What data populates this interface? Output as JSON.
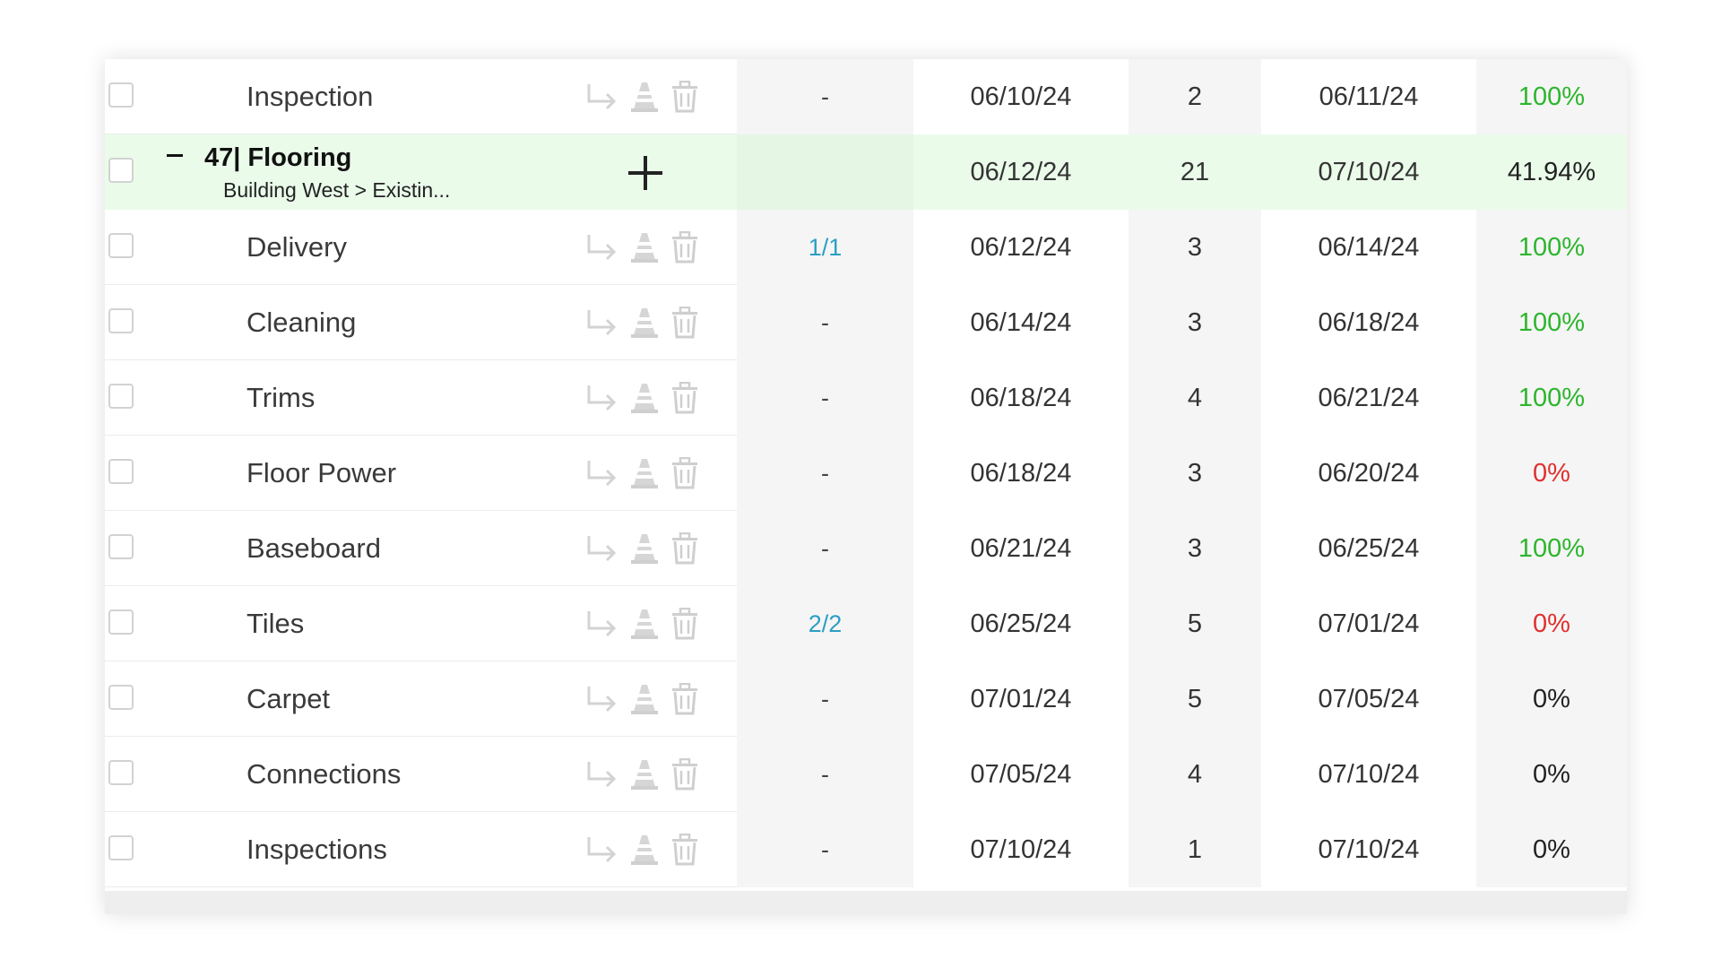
{
  "colors": {
    "group_bg": "#eafbea",
    "link": "#2a9fc4",
    "complete": "#2db52d",
    "not_started": "#e03030",
    "neutral": "#222222"
  },
  "icons": {
    "indent": "indent-arrow-icon",
    "constraint": "cone-icon",
    "delete": "trash-icon",
    "collapse": "minus-icon",
    "add": "plus-icon"
  },
  "rows": [
    {
      "type": "task",
      "name": "Inspection",
      "sub": "-",
      "start": "06/10/24",
      "duration": "2",
      "end": "06/11/24",
      "percent": "100%",
      "status": "green"
    },
    {
      "type": "group",
      "name": "47| Flooring",
      "path": "Building West > Existin...",
      "sub": "",
      "start": "06/12/24",
      "duration": "21",
      "end": "07/10/24",
      "percent": "41.94%",
      "status": "black"
    },
    {
      "type": "task",
      "name": "Delivery",
      "sub": "1/1",
      "start": "06/12/24",
      "duration": "3",
      "end": "06/14/24",
      "percent": "100%",
      "status": "green"
    },
    {
      "type": "task",
      "name": "Cleaning",
      "sub": "-",
      "start": "06/14/24",
      "duration": "3",
      "end": "06/18/24",
      "percent": "100%",
      "status": "green"
    },
    {
      "type": "task",
      "name": "Trims",
      "sub": "-",
      "start": "06/18/24",
      "duration": "4",
      "end": "06/21/24",
      "percent": "100%",
      "status": "green"
    },
    {
      "type": "task",
      "name": "Floor Power",
      "sub": "-",
      "start": "06/18/24",
      "duration": "3",
      "end": "06/20/24",
      "percent": "0%",
      "status": "red"
    },
    {
      "type": "task",
      "name": "Baseboard",
      "sub": "-",
      "start": "06/21/24",
      "duration": "3",
      "end": "06/25/24",
      "percent": "100%",
      "status": "green"
    },
    {
      "type": "task",
      "name": "Tiles",
      "sub": "2/2",
      "start": "06/25/24",
      "duration": "5",
      "end": "07/01/24",
      "percent": "0%",
      "status": "red"
    },
    {
      "type": "task",
      "name": "Carpet",
      "sub": "-",
      "start": "07/01/24",
      "duration": "5",
      "end": "07/05/24",
      "percent": "0%",
      "status": "black"
    },
    {
      "type": "task",
      "name": "Connections",
      "sub": "-",
      "start": "07/05/24",
      "duration": "4",
      "end": "07/10/24",
      "percent": "0%",
      "status": "black"
    },
    {
      "type": "task",
      "name": "Inspections",
      "sub": "-",
      "start": "07/10/24",
      "duration": "1",
      "end": "07/10/24",
      "percent": "0%",
      "status": "black"
    }
  ]
}
